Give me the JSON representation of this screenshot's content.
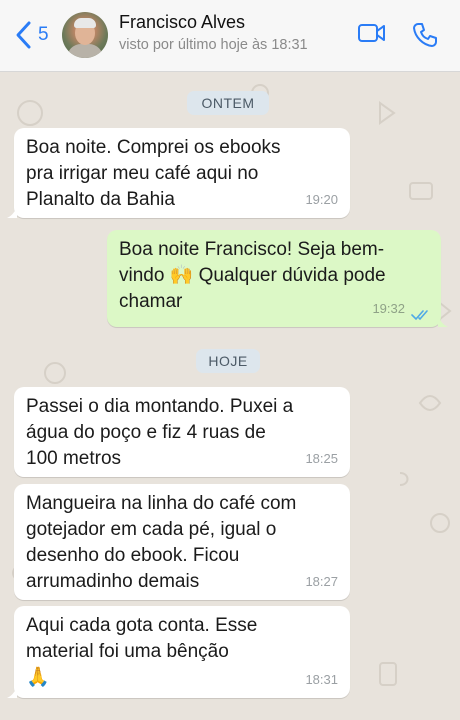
{
  "header": {
    "back_count": "5",
    "contact_name": "Francisco Alves",
    "last_seen": "visto por último hoje às 18:31",
    "accent_color": "#2a7cf6"
  },
  "icons": {
    "back": "chevron-left-icon",
    "video": "video-camera-icon",
    "phone": "phone-icon",
    "read": "double-check-icon"
  },
  "chat": {
    "date_chips": [
      "ONTEM",
      "HOJE"
    ],
    "messages": [
      {
        "direction": "in",
        "text": "Boa noite. Comprei os ebooks\npra irrigar meu café aqui no\nPlanalto da Bahia",
        "time": "19:20"
      },
      {
        "direction": "out",
        "text": "Boa noite Francisco! Seja bem-\nvindo 🙌  Qualquer dúvida pode\nchamar",
        "time": "19:32",
        "status": "read"
      },
      {
        "direction": "in",
        "text": "Passei o dia montando. Puxei a\nágua do poço e fiz 4 ruas de\n100 metros",
        "time": "18:25"
      },
      {
        "direction": "in",
        "text": "Mangueira na linha do café com\ngotejador em cada pé, igual o\ndesenho do ebook. Ficou\narrumadinho demais",
        "time": "18:27"
      },
      {
        "direction": "in",
        "text": "Aqui cada gota conta. Esse\nmaterial foi uma bênção\n🙏",
        "time": "18:31"
      }
    ],
    "colors": {
      "incoming": "#ffffff",
      "outgoing": "#dcf8c6",
      "wallpaper": "#e8e3dc",
      "read_ticks": "#4fa9e6"
    }
  }
}
